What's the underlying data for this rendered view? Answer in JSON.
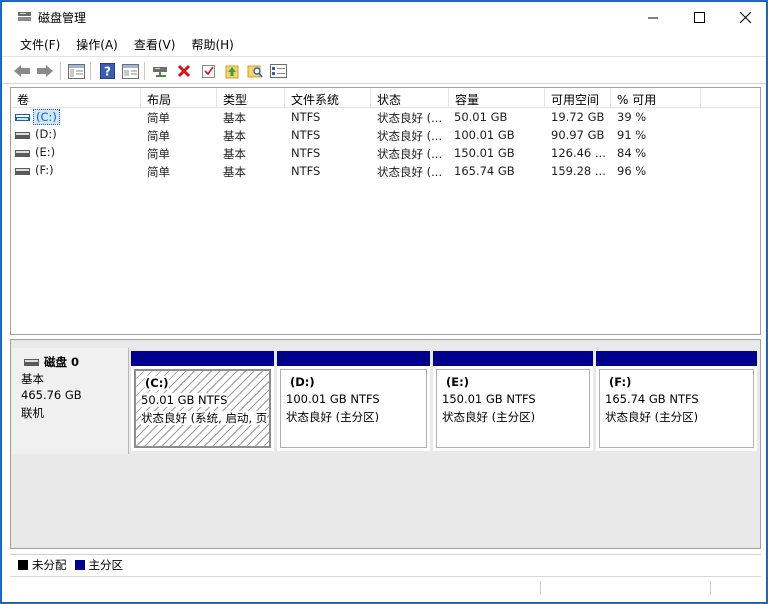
{
  "window": {
    "title": "磁盘管理"
  },
  "menu": [
    "文件(F)",
    "操作(A)",
    "查看(V)",
    "帮助(H)"
  ],
  "toolbar_icons": [
    "back-arrow-icon",
    "forward-arrow-icon",
    "console-tree-icon",
    "help-icon",
    "properties-icon",
    "connect-disk-icon",
    "delete-icon",
    "check-icon",
    "up-folder-icon",
    "search-folder-icon",
    "properties-list-icon"
  ],
  "columns": [
    "卷",
    "布局",
    "类型",
    "文件系统",
    "状态",
    "容量",
    "可用空间",
    "% 可用"
  ],
  "volumes": [
    {
      "name": "(C:)",
      "layout": "简单",
      "type": "基本",
      "fs": "NTFS",
      "status": "状态良好 (...",
      "capacity": "50.01 GB",
      "free": "19.72 GB",
      "pct": "39 %"
    },
    {
      "name": "(D:)",
      "layout": "简单",
      "type": "基本",
      "fs": "NTFS",
      "status": "状态良好 (...",
      "capacity": "100.01 GB",
      "free": "90.97 GB",
      "pct": "91 %"
    },
    {
      "name": "(E:)",
      "layout": "简单",
      "type": "基本",
      "fs": "NTFS",
      "status": "状态良好 (...",
      "capacity": "150.01 GB",
      "free": "126.46 ...",
      "pct": "84 %"
    },
    {
      "name": "(F:)",
      "layout": "简单",
      "type": "基本",
      "fs": "NTFS",
      "status": "状态良好 (...",
      "capacity": "165.74 GB",
      "free": "159.28 ...",
      "pct": "96 %"
    }
  ],
  "disk": {
    "name": "磁盘 0",
    "kind": "基本",
    "size": "465.76 GB",
    "state": "联机"
  },
  "partitions": [
    {
      "name": "(C:)",
      "size": "50.01 GB NTFS",
      "status": "状态良好 (系统, 启动, 页"
    },
    {
      "name": "(D:)",
      "size": "100.01 GB NTFS",
      "status": "状态良好 (主分区)"
    },
    {
      "name": "(E:)",
      "size": "150.01 GB NTFS",
      "status": "状态良好 (主分区)"
    },
    {
      "name": "(F:)",
      "size": "165.74 GB NTFS",
      "status": "状态良好 (主分区)"
    }
  ],
  "legend": [
    {
      "label": "未分配",
      "color": "#000000"
    },
    {
      "label": "主分区",
      "color": "#00008b"
    }
  ],
  "colors": {
    "primary_partition": "#00008b",
    "selection": "#cce8ff",
    "accent": "#1a5fb4"
  }
}
